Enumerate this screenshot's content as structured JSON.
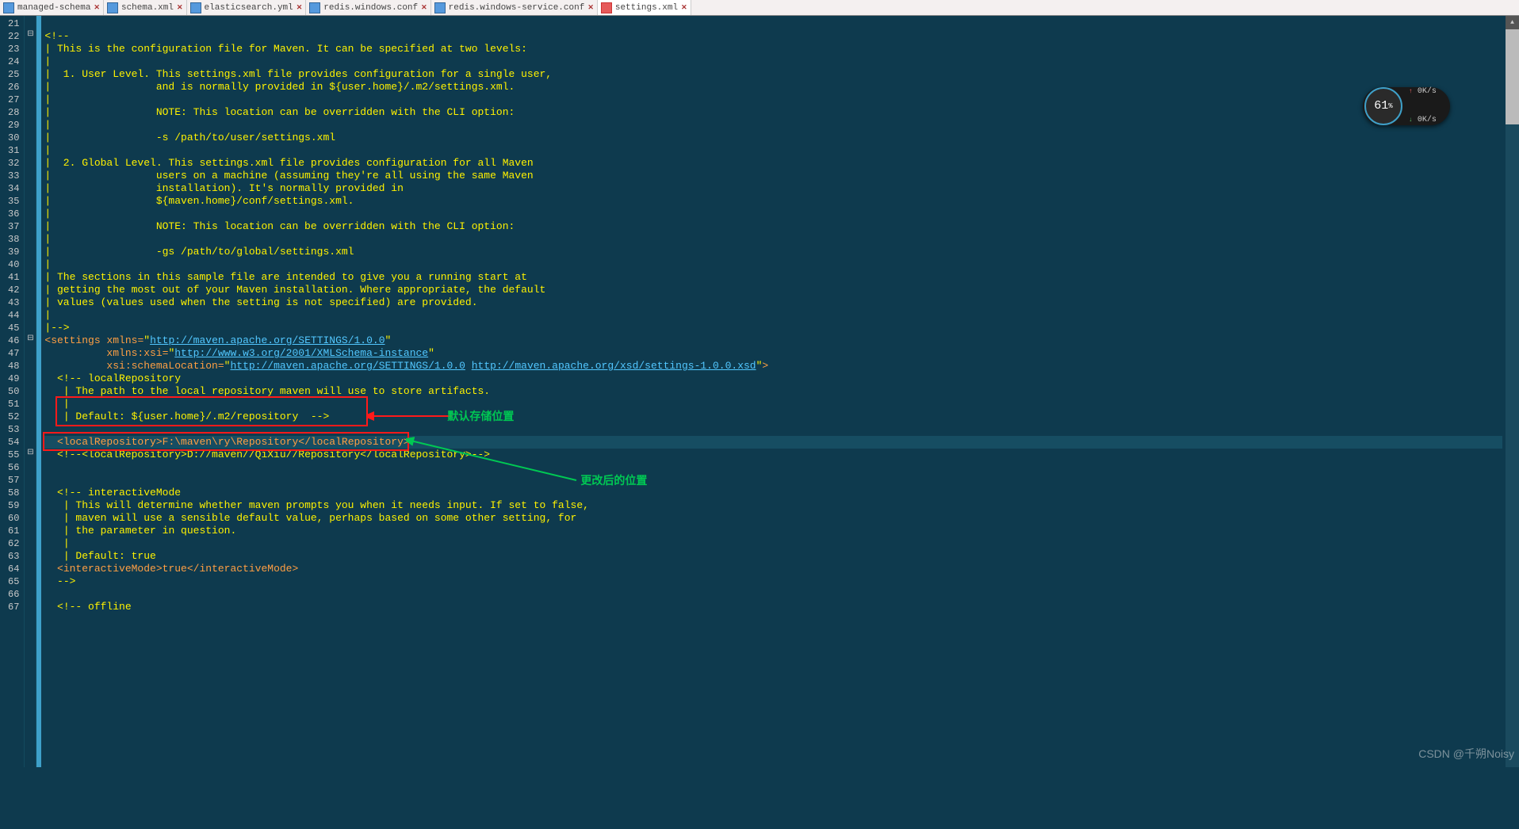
{
  "tabs": [
    {
      "label": "managed-schema",
      "active": false
    },
    {
      "label": "schema.xml",
      "active": false
    },
    {
      "label": "elasticsearch.yml",
      "active": false
    },
    {
      "label": "redis.windows.conf",
      "active": false
    },
    {
      "label": "redis.windows-service.conf",
      "active": false
    },
    {
      "label": "settings.xml",
      "active": true
    }
  ],
  "gutter": {
    "start": 21,
    "end": 67
  },
  "fold": {
    "22": "⊟",
    "46": "⊟",
    "55": "⊟"
  },
  "code": [
    {
      "n": 21,
      "html": "<span class='comment'></span>"
    },
    {
      "n": 22,
      "html": "<span class='comment'>&lt;!--</span>"
    },
    {
      "n": 23,
      "html": "<span class='comment'>| This is the configuration file for Maven. It can be specified at two levels:</span>"
    },
    {
      "n": 24,
      "html": "<span class='comment'>|</span>"
    },
    {
      "n": 25,
      "html": "<span class='comment'>|  1. User Level. This settings.xml file provides configuration for a single user,</span>"
    },
    {
      "n": 26,
      "html": "<span class='comment'>|                 and is normally provided in ${user.home}/.m2/settings.xml.</span>"
    },
    {
      "n": 27,
      "html": "<span class='comment'>|</span>"
    },
    {
      "n": 28,
      "html": "<span class='comment'>|                 NOTE: This location can be overridden with the CLI option:</span>"
    },
    {
      "n": 29,
      "html": "<span class='comment'>|</span>"
    },
    {
      "n": 30,
      "html": "<span class='comment'>|                 -s /path/to/user/settings.xml</span>"
    },
    {
      "n": 31,
      "html": "<span class='comment'>|</span>"
    },
    {
      "n": 32,
      "html": "<span class='comment'>|  2. Global Level. This settings.xml file provides configuration for all Maven</span>"
    },
    {
      "n": 33,
      "html": "<span class='comment'>|                 users on a machine (assuming they're all using the same Maven</span>"
    },
    {
      "n": 34,
      "html": "<span class='comment'>|                 installation). It's normally provided in</span>"
    },
    {
      "n": 35,
      "html": "<span class='comment'>|                 ${maven.home}/conf/settings.xml.</span>"
    },
    {
      "n": 36,
      "html": "<span class='comment'>|</span>"
    },
    {
      "n": 37,
      "html": "<span class='comment'>|                 NOTE: This location can be overridden with the CLI option:</span>"
    },
    {
      "n": 38,
      "html": "<span class='comment'>|</span>"
    },
    {
      "n": 39,
      "html": "<span class='comment'>|                 -gs /path/to/global/settings.xml</span>"
    },
    {
      "n": 40,
      "html": "<span class='comment'>|</span>"
    },
    {
      "n": 41,
      "html": "<span class='comment'>| The sections in this sample file are intended to give you a running start at</span>"
    },
    {
      "n": 42,
      "html": "<span class='comment'>| getting the most out of your Maven installation. Where appropriate, the default</span>"
    },
    {
      "n": 43,
      "html": "<span class='comment'>| values (values used when the setting is not specified) are provided.</span>"
    },
    {
      "n": 44,
      "html": "<span class='comment'>|</span>"
    },
    {
      "n": 45,
      "html": "<span class='comment'>|--&gt;</span>"
    },
    {
      "n": 46,
      "html": "<span class='tag'>&lt;settings</span> <span class='attr'>xmlns=</span><span class='string'>\"</span><span class='url'>http://maven.apache.org/SETTINGS/1.0.0</span><span class='string'>\"</span>"
    },
    {
      "n": 47,
      "html": "          <span class='attr'>xmlns:xsi=</span><span class='string'>\"</span><span class='url'>http://www.w3.org/2001/XMLSchema-instance</span><span class='string'>\"</span>"
    },
    {
      "n": 48,
      "html": "          <span class='attr'>xsi:schemaLocation=</span><span class='string'>\"</span><span class='url'>http://maven.apache.org/SETTINGS/1.0.0</span> <span class='url'>http://maven.apache.org/xsd/settings-1.0.0.xsd</span><span class='string'>\"</span><span class='tag'>&gt;</span>"
    },
    {
      "n": 49,
      "html": "  <span class='comment'>&lt;!-- localRepository</span>"
    },
    {
      "n": 50,
      "html": "  <span class='comment'> | The path to the local repository maven will use to store artifacts.</span>"
    },
    {
      "n": 51,
      "html": "  <span class='comment'> |</span>"
    },
    {
      "n": 52,
      "html": "  <span class='comment'> | Default: ${user.home}/.m2/repository  --&gt;</span>"
    },
    {
      "n": 53,
      "html": ""
    },
    {
      "n": 54,
      "html": "  <span class='tag'>&lt;localRepository&gt;</span><span class='value'>F:\\maven\\ry\\Repository</span><span class='tag'>&lt;/localRepository&gt;</span>",
      "current": true
    },
    {
      "n": 55,
      "html": "  <span class='comment'>&lt;!--&lt;localRepository&gt;D://maven//QiXiu//Repository&lt;/localRepository&gt;--&gt;</span>"
    },
    {
      "n": 56,
      "html": ""
    },
    {
      "n": 57,
      "html": ""
    },
    {
      "n": 58,
      "html": "  <span class='comment'>&lt;!-- interactiveMode</span>"
    },
    {
      "n": 59,
      "html": "  <span class='comment'> | This will determine whether maven prompts you when it needs input. If set to false,</span>"
    },
    {
      "n": 60,
      "html": "  <span class='comment'> | maven will use a sensible default value, perhaps based on some other setting, for</span>"
    },
    {
      "n": 61,
      "html": "  <span class='comment'> | the parameter in question.</span>"
    },
    {
      "n": 62,
      "html": "  <span class='comment'> |</span>"
    },
    {
      "n": 63,
      "html": "  <span class='comment'> | Default: true</span>"
    },
    {
      "n": 64,
      "html": "  <span class='tag'>&lt;interactiveMode&gt;</span><span class='value'>true</span><span class='tag'>&lt;/interactiveMode&gt;</span>"
    },
    {
      "n": 65,
      "html": "  <span class='comment'>--&gt;</span>"
    },
    {
      "n": 66,
      "html": ""
    },
    {
      "n": 67,
      "html": "  <span class='comment'>&lt;!-- offline</span>"
    }
  ],
  "annotations": {
    "label_default": "默认存储位置",
    "label_changed": "更改后的位置"
  },
  "perf": {
    "percent": "61",
    "percent_unit": "%",
    "up": "0K/s",
    "down": "0K/s"
  },
  "watermark": "CSDN @千朔Noisy"
}
